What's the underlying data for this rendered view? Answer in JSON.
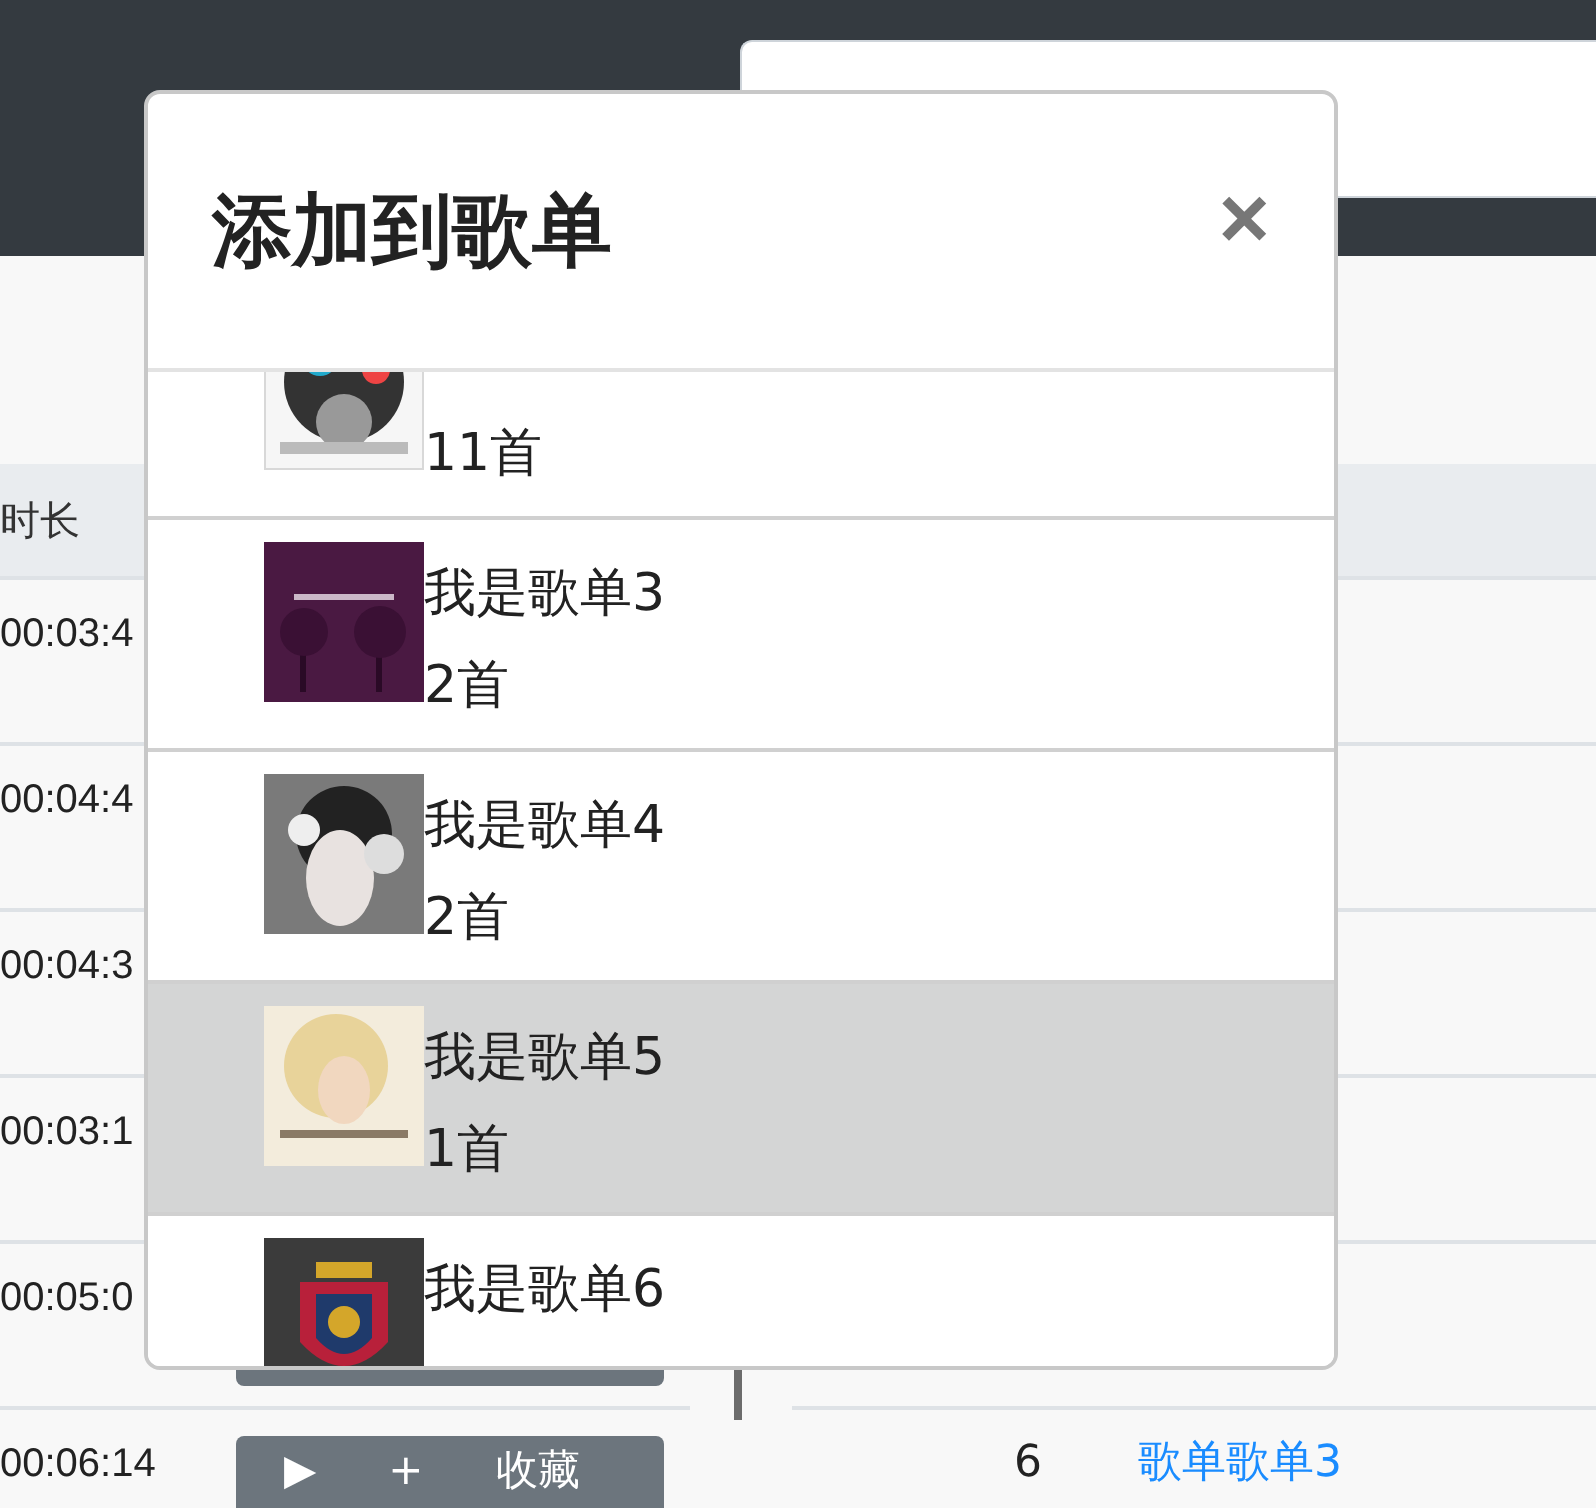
{
  "left_table": {
    "header": "时长",
    "rows": [
      {
        "duration": "00:03:4"
      },
      {
        "duration": "00:04:4"
      },
      {
        "duration": "00:04:3"
      },
      {
        "duration": "00:03:1"
      },
      {
        "duration": "00:05:0"
      },
      {
        "duration": "00:06:14",
        "actions": [
          "▶",
          "+",
          "收藏"
        ]
      }
    ]
  },
  "right_table": {
    "rows": [
      {
        "index": "6",
        "name": "歌单歌单3"
      }
    ]
  },
  "modal": {
    "title": "添加到歌单",
    "close": "×",
    "playlists": [
      {
        "count": "11首",
        "selected": false
      },
      {
        "title": "我是歌单3",
        "count": "2首",
        "selected": false
      },
      {
        "title": "我是歌单4",
        "count": "2首",
        "selected": false
      },
      {
        "title": "我是歌单5",
        "count": "1首",
        "selected": true
      },
      {
        "title": "我是歌单6",
        "selected": false
      }
    ]
  }
}
